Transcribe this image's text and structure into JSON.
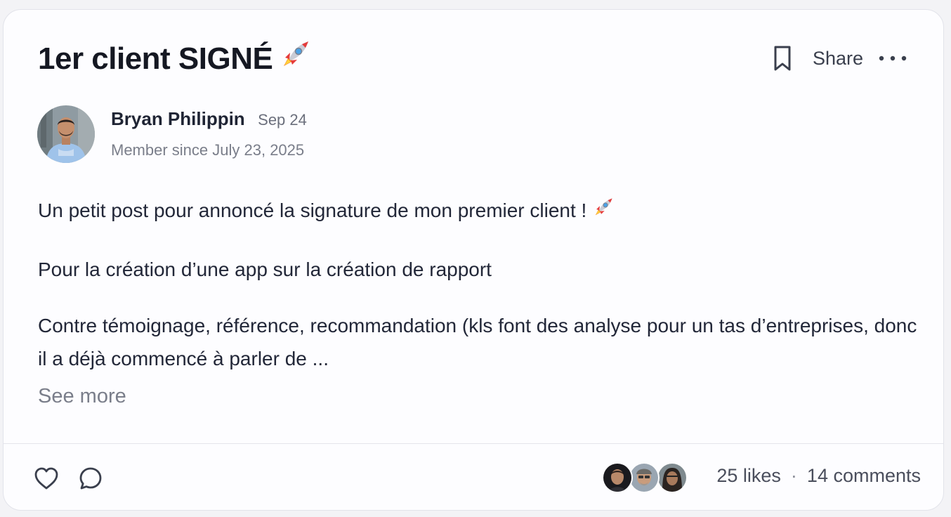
{
  "post": {
    "title": "1er client SIGNÉ",
    "title_emoji": "rocket",
    "actions": {
      "bookmark_icon": "bookmark-icon",
      "share_label": "Share",
      "more_icon": "more-horizontal-icon"
    },
    "author": {
      "name": "Bryan Philippin",
      "date": "Sep 24",
      "member_since": "Member since July 23, 2025"
    },
    "body": {
      "paragraph_1": "Un petit post pour annoncé la signature de mon premier client !",
      "paragraph_2": "Pour la création d’une app sur la création de rapport",
      "paragraph_3": "Contre témoignage, référence, recommandation (kls font des analyse pour un tas d’entreprises, donc il a déjà commencé à parler de ..."
    },
    "see_more": "See more"
  },
  "footer": {
    "like_icon": "heart-icon",
    "comment_icon": "comment-bubble-icon",
    "likes": "25 likes",
    "separator": "·",
    "comments": "14 comments"
  },
  "colors": {
    "card_bg": "#fdfdff",
    "border": "#e2e3ea",
    "text": "#1f2434",
    "muted": "#7a7e8a"
  }
}
